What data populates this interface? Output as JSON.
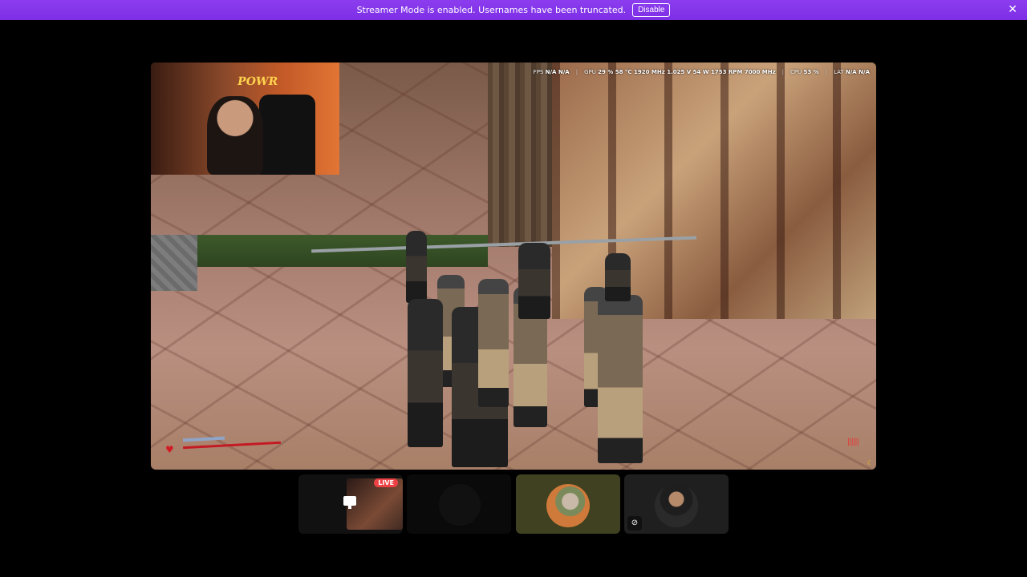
{
  "banner": {
    "message": "Streamer Mode is enabled. Usernames have been truncated.",
    "disable_label": "Disable",
    "close_icon": "close-icon"
  },
  "stream": {
    "webcam_logo": "POWR",
    "hud": {
      "fps_label": "FPS",
      "fps_values": "N/A  N/A",
      "gpu_label": "GPU",
      "gpu_values": "29 %  58 °C  1920 MHz  1.025 V  54 W  1753 RPM  7000 MHz",
      "cpu_label": "CPU",
      "cpu_values": "53 %",
      "lat_label": "LAT",
      "lat_values": "N/A  N/A"
    }
  },
  "tiles": [
    {
      "type": "screen-share",
      "live_label": "LIVE",
      "icon": "monitor-icon"
    },
    {
      "type": "camera-off"
    },
    {
      "type": "avatar"
    },
    {
      "type": "avatar",
      "muted_icon": "camera-off-icon"
    }
  ],
  "colors": {
    "banner": "#8b3dee",
    "live": "#ed4245",
    "health": "#c41a24"
  }
}
